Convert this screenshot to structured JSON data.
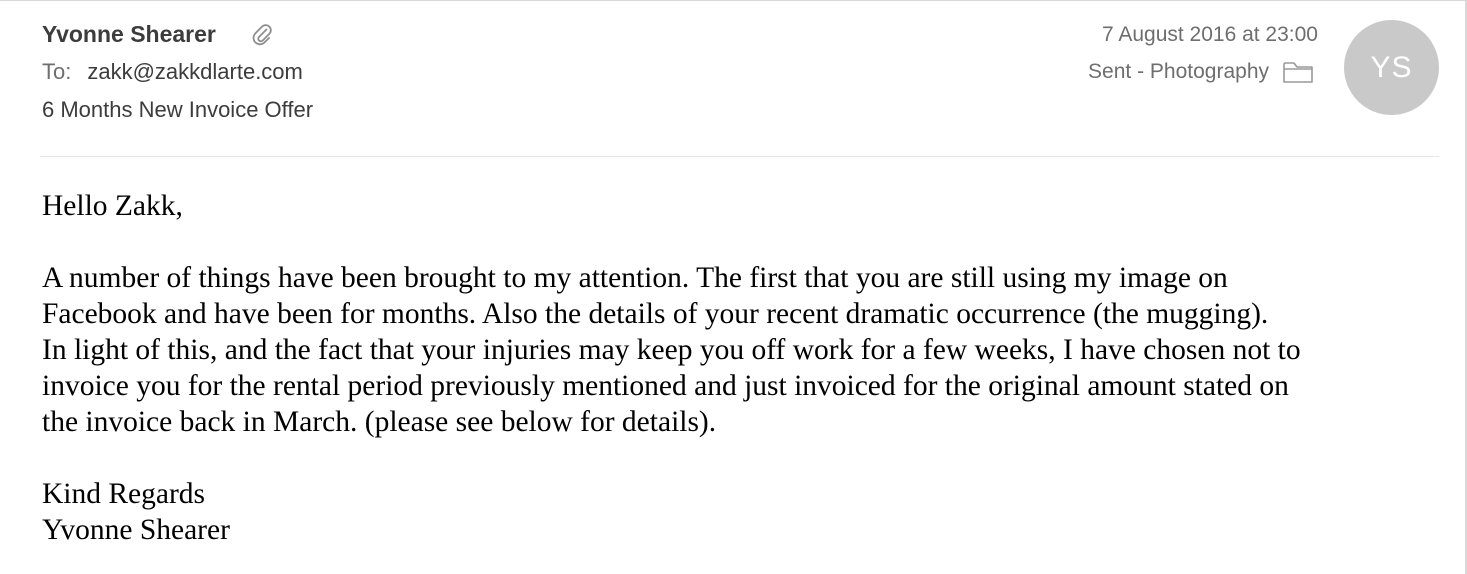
{
  "message": {
    "sender_name": "Yvonne Shearer",
    "to_label": "To:",
    "to_address": "zakk@zakkdlarte.com",
    "subject": "6 Months New Invoice Offer",
    "date": "7 August 2016 at 23:00",
    "mailbox": "Sent - Photography",
    "avatar_initials": "YS",
    "icons": {
      "attachment": "paperclip-icon",
      "mailbox": "folder-icon"
    },
    "colors": {
      "avatar_bg": "#c9c9c9",
      "meta_text": "#6e6e6e"
    }
  },
  "body": {
    "greeting": "Hello Zakk,",
    "lines": [
      "A number of things have been brought to my attention. The first that you are still using my image on",
      "Facebook and have been for months. Also the details of your recent dramatic occurrence (the mugging).",
      "In light of this, and the fact that your injuries may keep you off work for a few weeks, I have chosen not to",
      "invoice you for the rental period previously mentioned and just invoiced for the original amount stated on",
      "the invoice back in March. (please see below for details)."
    ],
    "closing": "Kind Regards",
    "signature": "Yvonne Shearer"
  }
}
